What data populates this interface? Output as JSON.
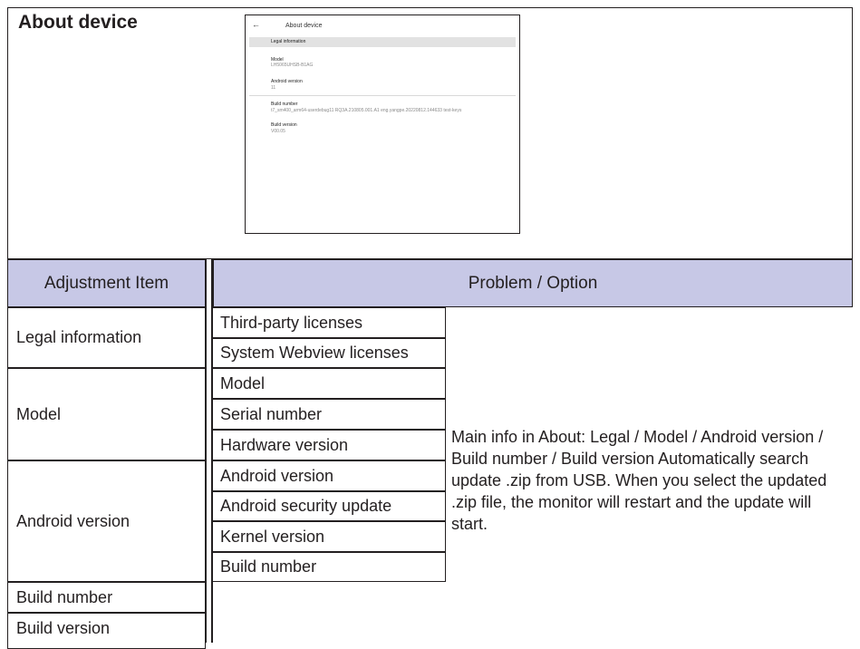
{
  "section_title": "About device",
  "screenshot": {
    "back_glyph": "←",
    "title": "About device",
    "highlighted_item": "Legal information",
    "entries": [
      {
        "label": "Model",
        "value": "LH5065UHSB-B1AG"
      },
      {
        "label": "Android version",
        "value": "11"
      },
      {
        "label": "Build number",
        "value": "t7_sm400_arm64-userdebug11 RQ3A.210805.001.A1 eng.yangpe.20220812.144633 test-keys"
      },
      {
        "label": "Build version",
        "value": "V00.05"
      }
    ]
  },
  "table": {
    "col_adjustment": "Adjustment Item",
    "col_problem": "Problem / Option",
    "groups": [
      {
        "item": "Legal information",
        "options": [
          "Third-party licenses",
          "System Webview licenses"
        ]
      },
      {
        "item": "Model",
        "options": [
          "Model",
          "Serial number",
          "Hardware version"
        ]
      },
      {
        "item": "Android version",
        "options": [
          "Android version",
          "Android security update",
          "Kernel version",
          "Build number"
        ]
      },
      {
        "item": "Build number",
        "options": []
      },
      {
        "item": "Build version",
        "options": []
      }
    ],
    "description": "Main info in About: Legal / Model / Android version / Build number / Build version Automatically search update .zip from USB. When you select the updated .zip file, the monitor will restart and the update will start."
  }
}
